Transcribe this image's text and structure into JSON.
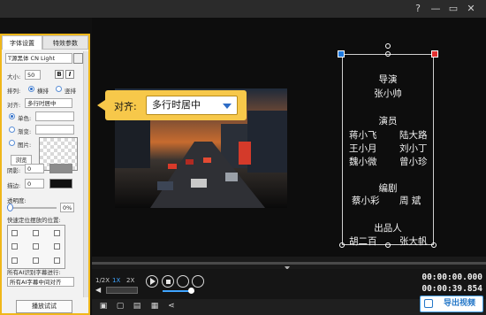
{
  "window": {
    "buttons": [
      "?",
      "—",
      "▭",
      "✕"
    ]
  },
  "left_panel": {
    "tabs": [
      "字体设置",
      "特效参数"
    ],
    "font_name": "T源黑体 CN Light",
    "size_label": "大小:",
    "size_value": "50",
    "bold": "B",
    "italic": "I",
    "layout_label": "排列:",
    "layout_options": [
      "横排",
      "竖排"
    ],
    "align_label": "对齐:",
    "align_value": "多行时居中",
    "solid_label": "单色:",
    "gradient_label": "渐变:",
    "image_label": "图片:",
    "browse": "浏览",
    "shadow_label": "阴影:",
    "shadow_value": "0",
    "stroke_label": "描边:",
    "stroke_value": "0",
    "opacity_label": "透明度:",
    "opacity_value": "0%",
    "position_label": "快速定位摆放的位置:",
    "ai_label": "所有AI识别字幕进行:",
    "ai_value": "所有AI字幕中间对齐",
    "preview_button": "播放试试"
  },
  "tooltip": {
    "label": "对齐:",
    "value": "多行时居中"
  },
  "credits": {
    "director_title": "导演",
    "director_name": "张小帅",
    "cast_title": "演员",
    "cast": [
      [
        "蒋小飞",
        "陆大路"
      ],
      [
        "王小月",
        "刘小丁"
      ],
      [
        "魏小微",
        "曾小珍"
      ]
    ],
    "writer_title": "编剧",
    "writers": [
      "蔡小彩",
      "周 斌"
    ],
    "producer_title": "出品人",
    "producers": [
      "胡二百",
      "张大帆"
    ]
  },
  "playback": {
    "speeds": [
      "1/2X",
      "1X",
      "2X"
    ],
    "time_current": "00:00:00.000",
    "time_total": "00:00:39.854"
  },
  "export_button": "导出视频"
}
